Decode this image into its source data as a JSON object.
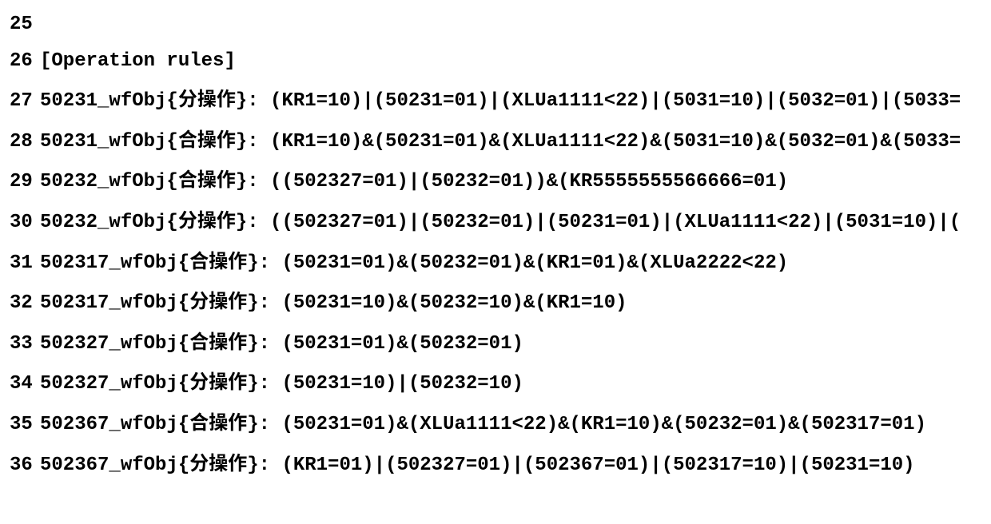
{
  "lines": [
    {
      "num": "25",
      "content": ""
    },
    {
      "num": "26",
      "content": "[Operation rules]"
    },
    {
      "num": "27",
      "prefix": "50231_wfObj{",
      "zh": "分操作",
      "suffix": "}:  (KR1=10)|(50231=01)|(XLUa1111<22)|(5031=10)|(5032=01)|(5033="
    },
    {
      "num": "28",
      "prefix": "50231_wfObj{",
      "zh": "合操作",
      "suffix": "}:  (KR1=10)&(50231=01)&(XLUa1111<22)&(5031=10)&(5032=01)&(5033="
    },
    {
      "num": "29",
      "prefix": "50232_wfObj{",
      "zh": "合操作",
      "suffix": "}:  ((502327=01)|(50232=01))&(KR5555555566666=01)"
    },
    {
      "num": "30",
      "prefix": "50232_wfObj{",
      "zh": "分操作",
      "suffix": "}:  ((502327=01)|(50232=01)|(50231=01)|(XLUa1111<22)|(5031=10)|("
    },
    {
      "num": "31",
      "prefix": "502317_wfObj{",
      "zh": "合操作",
      "suffix": "}:  (50231=01)&(50232=01)&(KR1=01)&(XLUa2222<22)"
    },
    {
      "num": "32",
      "prefix": "502317_wfObj{",
      "zh": "分操作",
      "suffix": "}:  (50231=10)&(50232=10)&(KR1=10)"
    },
    {
      "num": "33",
      "prefix": "502327_wfObj{",
      "zh": "合操作",
      "suffix": "}:  (50231=01)&(50232=01)"
    },
    {
      "num": "34",
      "prefix": "502327_wfObj{",
      "zh": "分操作",
      "suffix": "}:  (50231=10)|(50232=10)"
    },
    {
      "num": "35",
      "prefix": "502367_wfObj{",
      "zh": "合操作",
      "suffix": "}:  (50231=01)&(XLUa1111<22)&(KR1=10)&(50232=01)&(502317=01)"
    },
    {
      "num": "36",
      "prefix": "502367_wfObj{",
      "zh": "分操作",
      "suffix": "}:  (KR1=01)|(502327=01)|(502367=01)|(502317=10)|(50231=10)"
    }
  ]
}
